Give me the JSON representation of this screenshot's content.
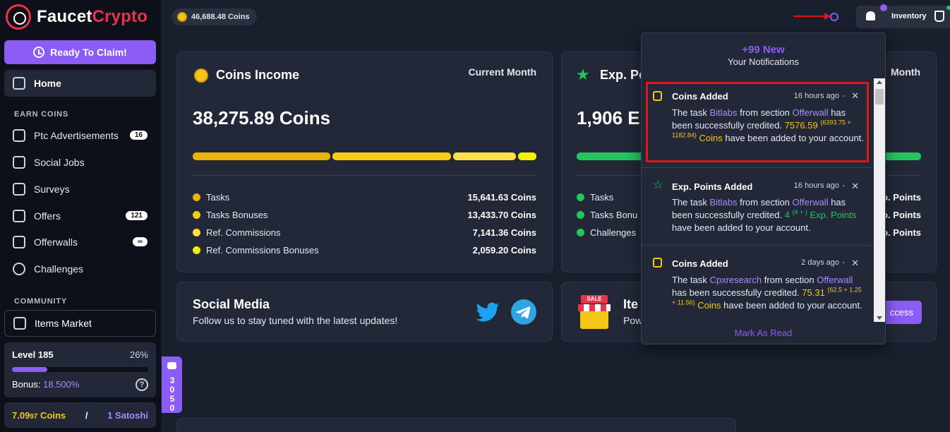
{
  "brand": {
    "part1": "Faucet",
    "part2": "Crypto"
  },
  "sidebar": {
    "claim_label": "Ready To Claim!",
    "home_label": "Home",
    "earn_title": "EARN COINS",
    "earn_items": [
      {
        "label": "Ptc Advertisements",
        "badge": "16"
      },
      {
        "label": "Social Jobs",
        "badge": ""
      },
      {
        "label": "Surveys",
        "badge": ""
      },
      {
        "label": "Offers",
        "badge": "121"
      },
      {
        "label": "Offerwalls",
        "badge": "∞"
      },
      {
        "label": "Challenges",
        "badge": ""
      }
    ],
    "community_title": "COMMUNITY",
    "market_label": "Items Market",
    "level": {
      "label": "Level 185",
      "percent_text": "26%",
      "progress": 0.26,
      "bonus_label": "Bonus:",
      "bonus_value": "18.500%",
      "help": "?"
    },
    "balance": {
      "coins_main": "7.09",
      "coins_small": "97",
      "coins_unit": " Coins",
      "separator": "/",
      "satoshi": "1 Satoshi"
    }
  },
  "topbar": {
    "coins": "46,688.48 Coins",
    "inventory_label": "Inventory"
  },
  "coins_income": {
    "title": "Coins Income",
    "period": "Current Month",
    "total": "38,275.89 Coins",
    "segments": [
      {
        "value": 15641.63,
        "color": "#eab308"
      },
      {
        "value": 13433.7,
        "color": "#facc15"
      },
      {
        "value": 7141.36,
        "color": "#fde047"
      },
      {
        "value": 2059.2,
        "color": "#f4f000"
      }
    ],
    "rows": [
      {
        "label": "Tasks",
        "value": "15,641.63 Coins",
        "color": "#eab308"
      },
      {
        "label": "Tasks Bonuses",
        "value": "13,433.70 Coins",
        "color": "#facc15"
      },
      {
        "label": "Ref. Commissions",
        "value": "7,141.36 Coins",
        "color": "#fde047"
      },
      {
        "label": "Ref. Commissions Bonuses",
        "value": "2,059.20 Coins",
        "color": "#f4f000"
      }
    ]
  },
  "exp_points": {
    "title": "Exp. Po",
    "period": "Month",
    "total": "1,906 E",
    "rows": [
      {
        "label": "Tasks",
        "value": "o. Points"
      },
      {
        "label": "Tasks Bonu",
        "value": "o. Points"
      },
      {
        "label": "Challenges",
        "value": "o. Points"
      }
    ]
  },
  "social": {
    "title": "Social Media",
    "subtitle": "Follow us to stay tuned with the latest updates!"
  },
  "items_card": {
    "title": "Ite",
    "subtitle": "Pow",
    "sign": "SALE",
    "button": "ccess"
  },
  "chat": {
    "count": "3050"
  },
  "notifications": {
    "head_new": "+99 New",
    "head_title": "Your Notifications",
    "mark_read": "Mark As Read",
    "items": [
      {
        "title": "Coins Added",
        "time": "16 hours ago"
      },
      {
        "title": "Exp. Points Added",
        "time": "16 hours ago"
      },
      {
        "title": "Coins Added",
        "time": "2 days ago"
      }
    ],
    "n1": {
      "p1": "The task ",
      "task": "Bitlabs",
      "p2": " from section ",
      "section": "Offerwall",
      "p3": " has been successfully credited. ",
      "amount": "7576.59",
      "breakdown": "(6393.75 + 1182.84)",
      "unit": "Coins",
      "p4": " have been added to your account."
    },
    "n2": {
      "p1": "The task ",
      "task": "Bitlabs",
      "p2": " from section ",
      "section": "Offerwall",
      "p3": " has been successfully credited. ",
      "amount": "4",
      "breakdown": "(4 + )",
      "unit": "Exp. Points",
      "p4": " have been added to your account."
    },
    "n3": {
      "p1": "The task ",
      "task": "Cpxresearch",
      "p2": " from section ",
      "section": "Offerwall",
      "p3": " has been successfully credited. ",
      "amount": "75.31",
      "breakdown": "(62.5 + 1.25 + 11.56)",
      "unit": "Coins",
      "p4": " have been added to your account."
    }
  }
}
